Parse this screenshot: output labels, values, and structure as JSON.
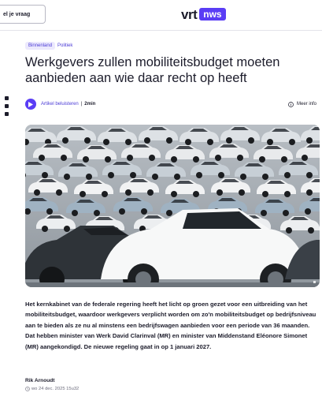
{
  "header": {
    "ask_button_label": "el je vraag",
    "logo_text": "vrt",
    "logo_badge": "nws",
    "brand_color": "#5a3df5"
  },
  "article": {
    "tags": [
      "Binnenland",
      "Politiek"
    ],
    "title": "Werkgevers zullen mobiliteitsbudget moeten aanbieden aan wie daar recht op heeft",
    "listen_label": "Artikel beluisteren",
    "separator": "|",
    "duration": "2min",
    "more_info_label": "Meer info",
    "hero_image_icon": "image-icon",
    "body": "Het kernkabinet van de federale regering heeft het licht op groen gezet voor een  uitbreiding van het mobiliteitsbudget, waardoor werkgevers verplicht worden om zo'n mobiliteitsbudget op bedrijfsniveau aan te bieden als ze nu al minstens een bedrijfswagen aanbieden voor een periode van 36 maanden. Dat hebben minister van Werk David Clarinval (MR) en minister van Middenstand Eléonore Simonet (MR) aangekondigd. De nieuwe regeling gaat in op 1 januari 2027.",
    "author": "Rik Arnoudt",
    "date": "wo 24 dec. 2025 15u32"
  }
}
